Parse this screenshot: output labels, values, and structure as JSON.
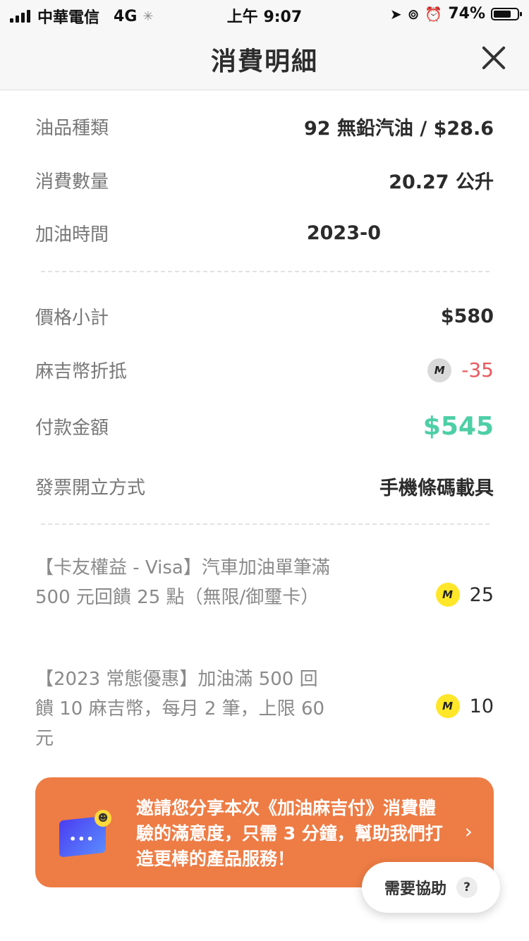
{
  "status_bar": {
    "carrier": "中華電信",
    "network": "4G",
    "time": "上午 9:07",
    "battery_text": "74%",
    "battery_level": 0.74
  },
  "nav": {
    "title": "消費明細",
    "close_icon": "close-icon"
  },
  "details": [
    {
      "label": "油品種類",
      "value": "92 無鉛汽油 / $28.6"
    },
    {
      "label": "消費數量",
      "value": "20.27 公升"
    },
    {
      "label": "加油時間",
      "value": "2023-0"
    }
  ],
  "summary": {
    "subtotal_label": "價格小計",
    "subtotal_value": "$580",
    "coin_label": "麻吉幣折抵",
    "coin_icon": "M",
    "coin_value": "-35",
    "payment_label": "付款金額",
    "payment_value": "$545",
    "invoice_label": "發票開立方式",
    "invoice_value": "手機條碼載具"
  },
  "benefits": [
    {
      "text": "【卡友權益 - Visa】汽車加油單筆滿 500 元回饋 25 點（無限/御璽卡）",
      "coin_icon": "M",
      "points": "25"
    },
    {
      "text": "【2023 常態優惠】加油滿 500 回饋 10 麻吉幣，每月 2 筆，上限 60 元",
      "coin_icon": "M",
      "points": "10"
    }
  ],
  "banner": {
    "text": "邀請您分享本次《加油麻吉付》消費體驗的滿意度，只需 3 分鐘，幫助我們打造更棒的產品服務！",
    "arrow": "›"
  },
  "help": {
    "label": "需要協助",
    "icon": "?"
  },
  "colors": {
    "negative": "#e8595d",
    "payment": "#4ecfa6",
    "banner": "#ee7c45",
    "coin_yellow": "#ffe629"
  }
}
